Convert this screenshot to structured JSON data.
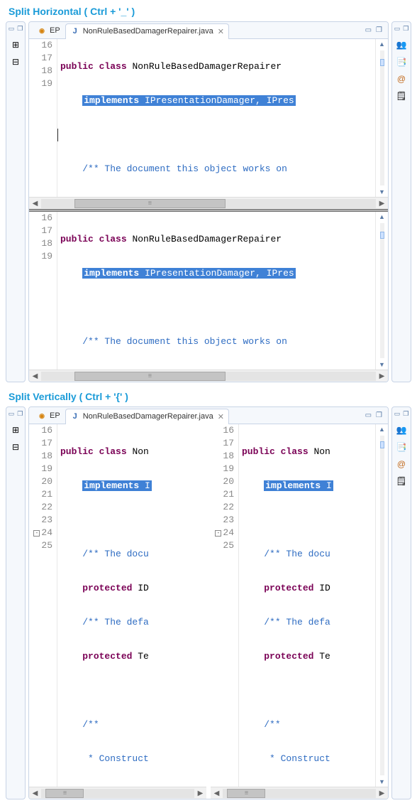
{
  "sections": {
    "horizontal_title": "Split Horizontal ( Ctrl  + '_' )",
    "vertical_title": "Split Vertically ( Ctrl + '{' )"
  },
  "tabs": {
    "ep_label": "EP",
    "file_label": "NonRuleBasedDamagerRepairer.java",
    "close_glyph": "✕"
  },
  "code_h": {
    "lines": [
      "16",
      "17",
      "18",
      "19"
    ],
    "l16_kw1": "public",
    "l16_kw2": "class",
    "l16_type": " NonRuleBasedDamagerRepairer",
    "l17_kw": "implements",
    "l17_rest": " IPresentationDamager, IPres",
    "l18": "",
    "l19_cmt": "/** The document this object works on "
  },
  "code_v": {
    "lines": [
      "16",
      "17",
      "18",
      "19",
      "20",
      "21",
      "22",
      "23",
      "24",
      "25"
    ],
    "l16_kw1": "public",
    "l16_kw2": "class",
    "l16_rest": " Non",
    "l17_kw": "implements",
    "l17_rest": " I",
    "l19_cmt": "/** The docu",
    "l20_kw": "protected",
    "l20_rest": " ID",
    "l21_cmt": "/** The defa",
    "l22_kw": "protected",
    "l22_rest": " Te",
    "l24_cmt": "/**",
    "l25_cmt": " * Construct"
  },
  "toolbar_icons": {
    "left1": "⊞",
    "left2": "⊟",
    "right1": "👥",
    "right2": "📑",
    "right3": "@",
    "right4": "🗒"
  },
  "colors": {
    "accent": "#1a9bd8",
    "keyword": "#7a0055",
    "comment": "#2e6cc2",
    "selection": "#3f81d6"
  }
}
